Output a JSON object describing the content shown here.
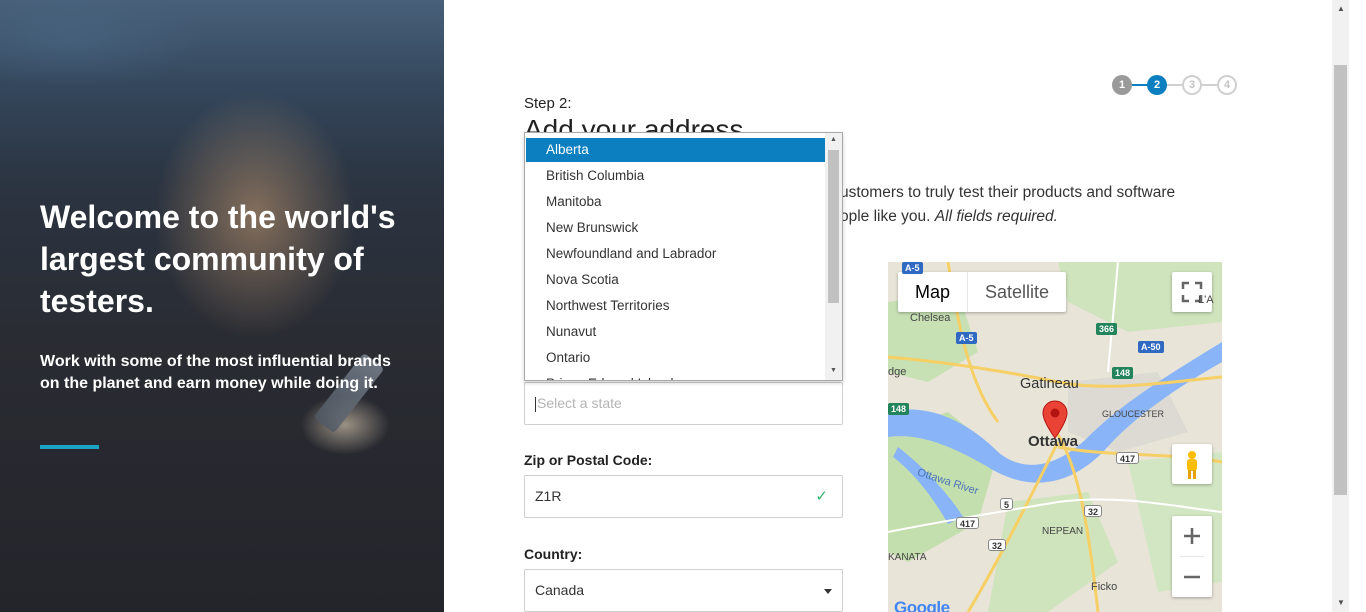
{
  "hero": {
    "headline": "Welcome to the world's largest community of testers.",
    "subheadline": "Work with some of the most influential brands on the planet and earn money while doing it."
  },
  "progress": {
    "steps": [
      "1",
      "2",
      "3",
      "4"
    ],
    "current_step": 2
  },
  "form": {
    "step_label": "Step 2:",
    "title": "Add your address",
    "intro_text": "ustomers to truly test their products and software",
    "intro_text_2": "ople like you. ",
    "intro_required": "All fields required.",
    "state_placeholder": "Select a state",
    "zip_label": "Zip or Postal Code:",
    "zip_value": "Z1R",
    "country_label": "Country:",
    "country_value": "Canada"
  },
  "state_listbox": {
    "options": [
      "Alberta",
      "British Columbia",
      "Manitoba",
      "New Brunswick",
      "Newfoundland and Labrador",
      "Nova Scotia",
      "Northwest Territories",
      "Nunavut",
      "Ontario",
      "Prince Edward Island"
    ],
    "selected": "Alberta"
  },
  "map": {
    "map_button": "Map",
    "satellite_button": "Satellite",
    "labels": {
      "chelsea": "Chelsea",
      "gatineau": "Gatineau",
      "ottawa": "Ottawa",
      "gloucester": "GLOUCESTER",
      "nepean": "NEPEAN",
      "kanata": "KANATA",
      "ficko": "Ficko",
      "ottawa_river": "Ottawa River",
      "laange": "L'A",
      "edge": "dge"
    },
    "shields": {
      "a5_top": "A-5",
      "a5": "A-5",
      "r366": "366",
      "a50": "A-50",
      "r148": "148",
      "r148_left": "148",
      "r417": "417",
      "r417b": "417",
      "r32": "32",
      "r32b": "32",
      "r5": "5"
    },
    "google_logo": "Google"
  },
  "colors": {
    "accent_blue": "#0b7fc0",
    "hero_accent": "#1aa3c4",
    "valid_green": "#35b36a"
  }
}
